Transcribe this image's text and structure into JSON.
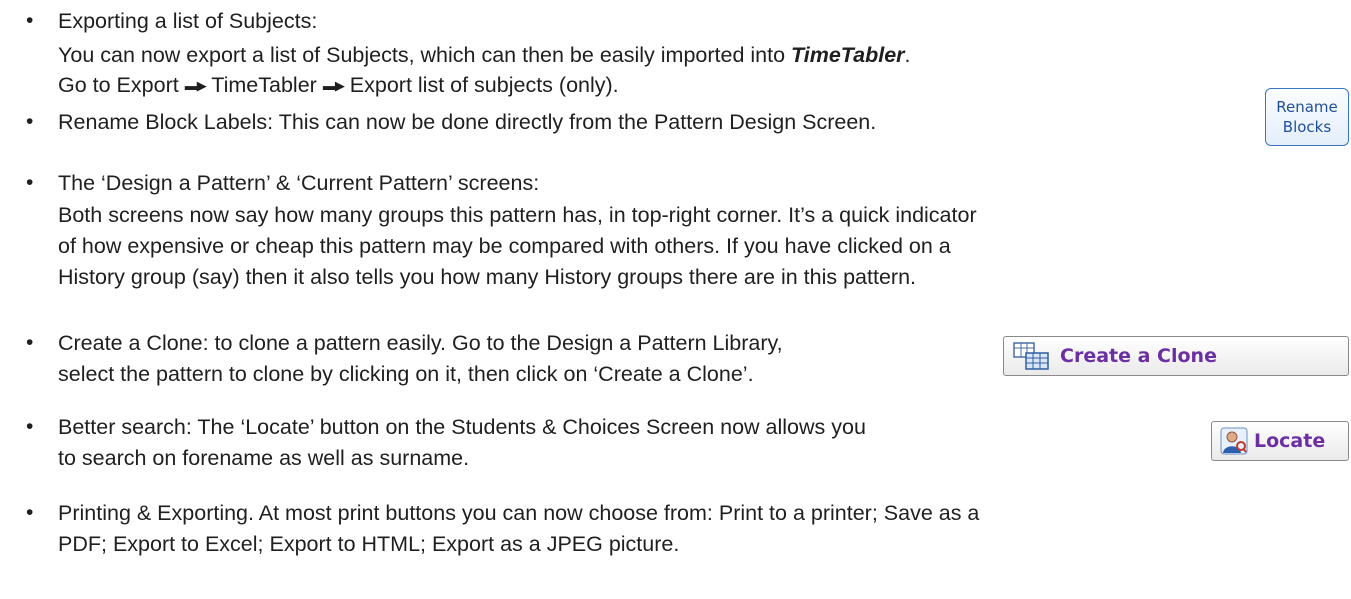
{
  "bullet_char": "•",
  "items": {
    "export_subjects": {
      "line1": "Exporting a list of Subjects:",
      "line2_pre": "You can now export a list of Subjects, which can then be easily imported into ",
      "line2_em": "TimeTabler",
      "line2_post": ".",
      "line3_a": "Go to Export",
      "line3_b": "TimeTabler",
      "line3_c": "Export list of subjects (only).",
      "arrow_glyph": "▬▶"
    },
    "rename_blocks": {
      "line1": "Rename Block Labels: This can now be done directly from the Pattern Design Screen.",
      "button_line1": "Rename",
      "button_line2": "Blocks"
    },
    "pattern_screens": {
      "line1": "The ‘Design a Pattern’ & ‘Current Pattern’ screens:",
      "line2": "Both screens now say how many groups this pattern has, in top-right corner.  It’s a quick indicator",
      "line3": "of how expensive or cheap this pattern may be compared with others.  If you have clicked on a",
      "line4": "History group (say) then it also tells you how many History groups there are in this pattern."
    },
    "create_clone": {
      "line1": "Create a Clone: to clone a pattern easily.  Go to the Design a Pattern Library,",
      "line2": "select the pattern to clone by clicking on it, then click on ‘Create a Clone’.",
      "button_label": "Create a Clone",
      "button_icon": "table-clone-icon"
    },
    "better_search": {
      "line1": "Better search: The ‘Locate’ button on the Students & Choices Screen now allows you",
      "line2": "to search on forename as well as surname.",
      "button_label": "Locate",
      "button_icon": "person-search-icon"
    },
    "printing": {
      "line1": "Printing & Exporting.  At most print buttons you can now choose from: Print to a printer; Save as a",
      "line2": "PDF; Export to Excel; Export to HTML; Export as a JPEG picture."
    }
  },
  "colors": {
    "text": "#1f1f1f",
    "button_label_purple": "#6b2fa3",
    "rename_border_blue": "#3b74c4",
    "rename_text_blue": "#1e4f9c"
  }
}
